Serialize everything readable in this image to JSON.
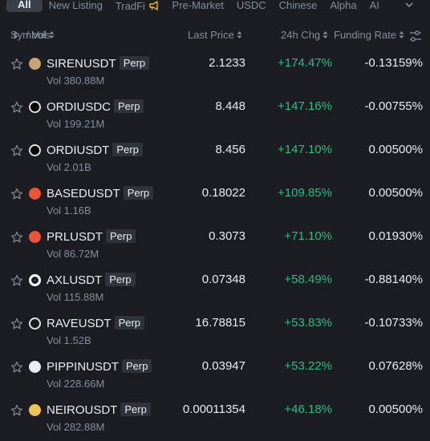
{
  "tabs": [
    {
      "label": "All",
      "active": true
    },
    {
      "label": "New Listing",
      "active": false
    },
    {
      "label": "TradFi",
      "active": false,
      "icon": "megaphone-icon"
    },
    {
      "label": "Pre-Market",
      "active": false
    },
    {
      "label": "USDC",
      "active": false
    },
    {
      "label": "Chinese",
      "active": false
    },
    {
      "label": "Alpha",
      "active": false
    },
    {
      "label": "AI",
      "active": false
    }
  ],
  "header": {
    "symbols": "Symbols",
    "vol": "/ Vol",
    "last_price": "Last Price",
    "change": "24h Chg",
    "funding": "Funding Rate"
  },
  "rows": [
    {
      "symbol": "SIRENUSDT",
      "badge": "Perp",
      "vol": "Vol 380.88M",
      "price": "2.1233",
      "change": "+174.47%",
      "funding": "-0.13159%",
      "coin_color": "#c9a27a",
      "coin_icon": "siren-coin-icon"
    },
    {
      "symbol": "ORDIUSDC",
      "badge": "Perp",
      "vol": "Vol 199.21M",
      "price": "8.448",
      "change": "+147.16%",
      "funding": "-0.00755%",
      "coin_color": "#000000",
      "coin_icon": "ordi-coin-icon"
    },
    {
      "symbol": "ORDIUSDT",
      "badge": "Perp",
      "vol": "Vol 2.01B",
      "price": "8.456",
      "change": "+147.10%",
      "funding": "0.00500%",
      "coin_color": "#000000",
      "coin_icon": "ordi-coin-icon"
    },
    {
      "symbol": "BASEDUSDT",
      "badge": "Perp",
      "vol": "Vol 1.16B",
      "price": "0.18022",
      "change": "+109.85%",
      "funding": "0.00500%",
      "coin_color": "#e8553a",
      "coin_icon": "based-coin-icon"
    },
    {
      "symbol": "PRLUSDT",
      "badge": "Perp",
      "vol": "Vol 86.72M",
      "price": "0.3073",
      "change": "+71.10%",
      "funding": "0.01930%",
      "coin_color": "#e8553a",
      "coin_icon": "prl-coin-icon"
    },
    {
      "symbol": "AXLUSDT",
      "badge": "Perp",
      "vol": "Vol 115.88M",
      "price": "0.07348",
      "change": "+58.49%",
      "funding": "-0.88140%",
      "coin_color": "#ffffff",
      "coin_icon": "axl-coin-icon"
    },
    {
      "symbol": "RAVEUSDT",
      "badge": "Perp",
      "vol": "Vol 1.52B",
      "price": "16.78815",
      "change": "+53.83%",
      "funding": "-0.10733%",
      "coin_color": "#1a1a1a",
      "coin_icon": "rave-coin-icon"
    },
    {
      "symbol": "PIPPINUSDT",
      "badge": "Perp",
      "vol": "Vol 228.66M",
      "price": "0.03947",
      "change": "+53.22%",
      "funding": "0.07628%",
      "coin_color": "#e9ecf2",
      "coin_icon": "pippin-coin-icon"
    },
    {
      "symbol": "NEIROUSDT",
      "badge": "Perp",
      "vol": "Vol 282.88M",
      "price": "0.00011354",
      "change": "+46.18%",
      "funding": "0.00500%",
      "coin_color": "#f0c35a",
      "coin_icon": "neiro-coin-icon"
    }
  ],
  "colors": {
    "background": "#1b1d22",
    "positive": "#2ebd85",
    "muted": "#848e9c",
    "accent": "#f0b90b"
  }
}
